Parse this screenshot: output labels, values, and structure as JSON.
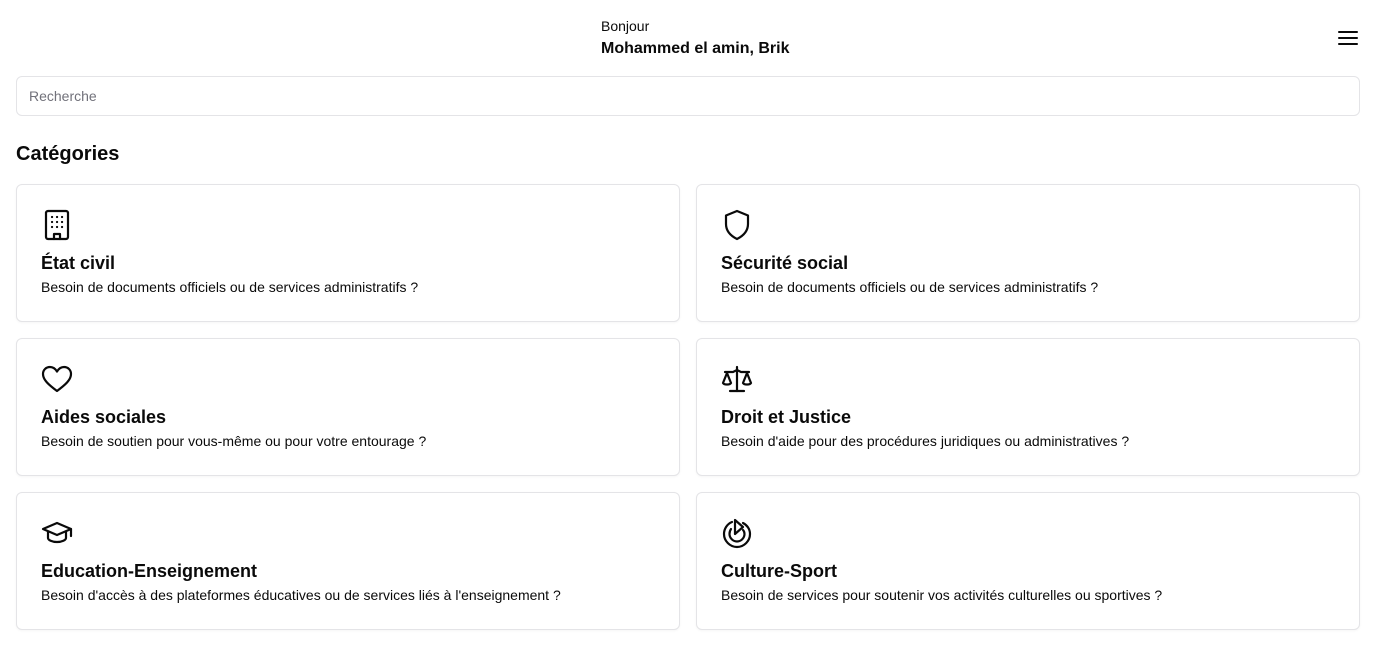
{
  "header": {
    "greeting": "Bonjour",
    "username": "Mohammed el amin, Brik",
    "menu_icon": "hamburger-menu-icon"
  },
  "search": {
    "placeholder": "Recherche",
    "value": ""
  },
  "categories": {
    "title": "Catégories",
    "items": [
      {
        "icon": "building-icon",
        "title": "État civil",
        "description": "Besoin de documents officiels ou de services administratifs ?"
      },
      {
        "icon": "shield-icon",
        "title": "Sécurité social",
        "description": "Besoin de documents officiels ou de services administratifs ?"
      },
      {
        "icon": "heart-icon",
        "title": "Aides sociales",
        "description": "Besoin de soutien pour vous-même ou pour votre entourage ?"
      },
      {
        "icon": "scale-icon",
        "title": "Droit et Justice",
        "description": "Besoin d'aide pour des procédures juridiques ou administratives ?"
      },
      {
        "icon": "graduation-cap-icon",
        "title": "Education-Enseignement",
        "description": "Besoin d'accès à des plateformes éducatives ou de services liés à l'enseignement ?"
      },
      {
        "icon": "target-play-icon",
        "title": "Culture-Sport",
        "description": "Besoin de services pour soutenir vos activités culturelles ou sportives ?"
      }
    ]
  }
}
